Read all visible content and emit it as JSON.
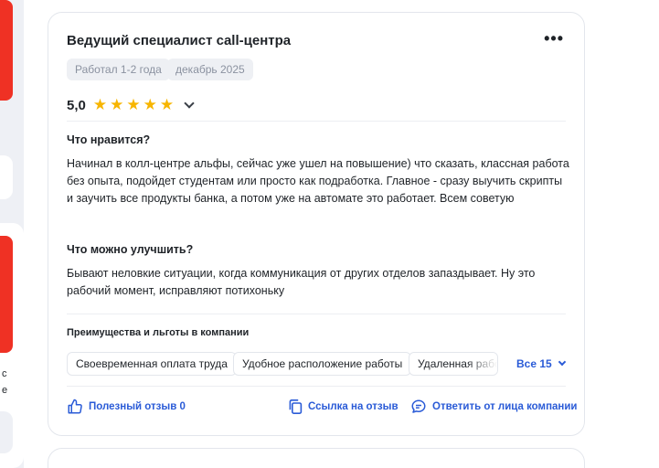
{
  "left_edge": {
    "text_line_1": "с",
    "text_line_2": "е"
  },
  "review": {
    "title": "Ведущий специалист call-центра",
    "more_icon": "more-dots-icon",
    "chips": [
      "Работал 1-2 года",
      "декабрь 2025"
    ],
    "rating": {
      "value": "5,0",
      "stars": 5,
      "max": 5
    },
    "likes_heading": "Что нравится?",
    "likes_text": "Начинал в колл-центре альфы, сейчас уже ушел на повышение) что сказать, классная работа без опыта, подойдет студентам или просто как подработка. Главное - сразу выучить скрипты и заучить все продукты банка, а потом уже на автомате это работает. Всем советую",
    "improve_heading": "Что можно улучшить?",
    "improve_text": "Бывают неловкие ситуации, когда коммуникация от других отделов запаздывает. Ну это рабочий момент, исправляют потихоньку",
    "benefits_title": "Преимущества и льготы в компании",
    "benefits": [
      "Своевременная оплата труда",
      "Удобное расположение работы",
      "Удаленная работа"
    ],
    "benefits_all_label": "Все 15",
    "actions": {
      "helpful": "Полезный отзыв 0",
      "link": "Ссылка на отзыв",
      "reply": "Ответить от лица компании"
    }
  },
  "colors": {
    "accent": "#2a5bd7",
    "star": "#f7b500",
    "brand_red": "#ef3124"
  }
}
